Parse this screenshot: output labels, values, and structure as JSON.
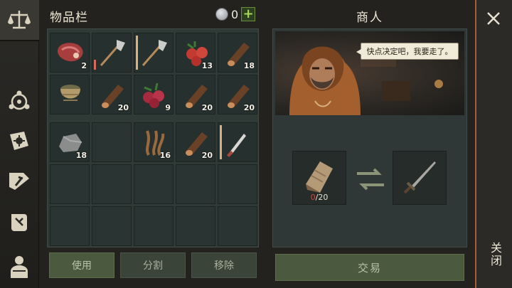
{
  "inventory": {
    "title": "物品栏",
    "currency": "0",
    "add_currency_label": "+",
    "slots": [
      {
        "item": "raw-meat",
        "qty": "2"
      },
      {
        "item": "stone-axe",
        "qty": ""
      },
      {
        "item": "stone-axe",
        "qty": ""
      },
      {
        "item": "berries",
        "qty": "13"
      },
      {
        "item": "log",
        "qty": "18"
      },
      {
        "item": "wicker-basket",
        "qty": ""
      },
      {
        "item": "log",
        "qty": "20"
      },
      {
        "item": "berries",
        "qty": "9"
      },
      {
        "item": "log",
        "qty": "20"
      },
      {
        "item": "log",
        "qty": "20"
      },
      {
        "item": "stone",
        "qty": "18"
      },
      {
        "item": "",
        "qty": ""
      },
      {
        "item": "plant-fiber",
        "qty": "16"
      },
      {
        "item": "log",
        "qty": "20"
      },
      {
        "item": "knife",
        "qty": ""
      }
    ],
    "buttons": {
      "use": "使用",
      "split": "分割",
      "remove": "移除"
    }
  },
  "merchant": {
    "title": "商人",
    "speech": "快点决定吧，我要走了。",
    "give": {
      "item": "wood-plank",
      "have": "0",
      "need": "/20"
    },
    "receive": {
      "item": "sword"
    },
    "trade_button": "交易"
  },
  "close": {
    "label": "关闭"
  },
  "colors": {
    "accent_green": "#a8d85b",
    "alert_red": "#d14c3e",
    "close_border": "#a8593f"
  }
}
